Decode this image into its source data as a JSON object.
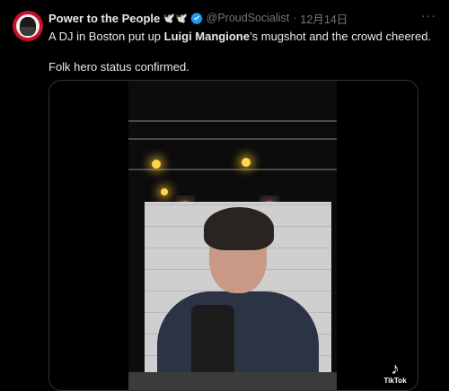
{
  "author": {
    "name": "Power to the People",
    "emoji": "🕊️🕊️",
    "handle": "@ProudSocialist",
    "separator": "·",
    "date": "12月14日",
    "avatar_icon": "avatar-icon",
    "verified_color": "#1d9bf0"
  },
  "menu": {
    "more_label": "···"
  },
  "post": {
    "text_before": "A DJ in Boston put up ",
    "text_bold": "Luigi Mangione",
    "text_after": "’s mugshot and the crowd cheered.",
    "text_second": "Folk hero status confirmed."
  },
  "media": {
    "watermark_icon": "tiktok-icon",
    "watermark_glyph": "♪",
    "watermark_label": "TikTok"
  }
}
